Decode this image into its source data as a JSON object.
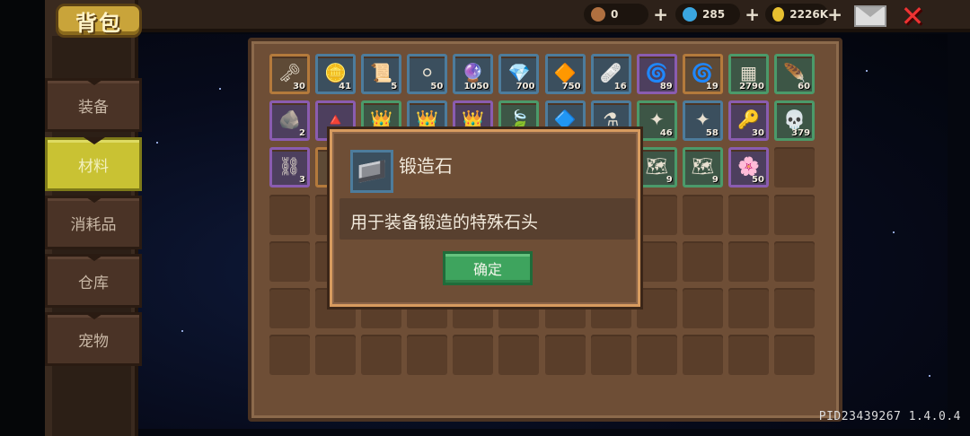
{
  "title": "背包",
  "tabs": [
    {
      "label": "装备",
      "active": false
    },
    {
      "label": "材料",
      "active": true
    },
    {
      "label": "消耗品",
      "active": false
    },
    {
      "label": "仓库",
      "active": false
    },
    {
      "label": "宠物",
      "active": false
    }
  ],
  "resources": [
    {
      "name": "sword-ticket",
      "value": "0",
      "color": "#b07040"
    },
    {
      "name": "gem",
      "value": "285",
      "color": "#3aa6e0"
    },
    {
      "name": "gold",
      "value": "2226K",
      "color": "#e8c030"
    }
  ],
  "items": [
    {
      "icon": "key-icon",
      "glyph": "🗝",
      "count": "30",
      "rarity": "orange"
    },
    {
      "icon": "coin-icon",
      "glyph": "🪙",
      "count": "41",
      "rarity": "blue"
    },
    {
      "icon": "scroll-icon",
      "glyph": "📜",
      "count": "5",
      "rarity": "blue"
    },
    {
      "icon": "orb-icon",
      "glyph": "⚪",
      "count": "50",
      "rarity": "blue"
    },
    {
      "icon": "purple-crystal-icon",
      "glyph": "🔮",
      "count": "1050",
      "rarity": "blue"
    },
    {
      "icon": "blue-crystal-icon",
      "glyph": "💎",
      "count": "700",
      "rarity": "blue"
    },
    {
      "icon": "gold-crystal-icon",
      "glyph": "🔶",
      "count": "750",
      "rarity": "blue"
    },
    {
      "icon": "bandage-icon",
      "glyph": "🩹",
      "count": "16",
      "rarity": "blue"
    },
    {
      "icon": "swirl-orb-icon",
      "glyph": "🌀",
      "count": "89",
      "rarity": "purple"
    },
    {
      "icon": "spiral-icon",
      "glyph": "🌀",
      "count": "19",
      "rarity": "orange"
    },
    {
      "icon": "chip-icon",
      "glyph": "▦",
      "count": "2790",
      "rarity": "green"
    },
    {
      "icon": "feather-icon",
      "glyph": "🪶",
      "count": "60",
      "rarity": "green"
    },
    {
      "icon": "ore-icon",
      "glyph": "🪨",
      "count": "2",
      "rarity": "purple"
    },
    {
      "icon": "prism-icon",
      "glyph": "🔺",
      "count": "",
      "rarity": "purple"
    },
    {
      "icon": "crown-icon",
      "glyph": "👑",
      "count": "",
      "rarity": "green"
    },
    {
      "icon": "crown-icon",
      "glyph": "👑",
      "count": "",
      "rarity": "blue"
    },
    {
      "icon": "crown-icon",
      "glyph": "👑",
      "count": "",
      "rarity": "purple"
    },
    {
      "icon": "leaf-icon",
      "glyph": "🍃",
      "count": "",
      "rarity": "green"
    },
    {
      "icon": "blade-icon",
      "glyph": "🔷",
      "count": "",
      "rarity": "blue"
    },
    {
      "icon": "potion-icon",
      "glyph": "⚗",
      "count": "",
      "rarity": "blue"
    },
    {
      "icon": "rune-icon",
      "glyph": "✦",
      "count": "46",
      "rarity": "green"
    },
    {
      "icon": "rune-icon",
      "glyph": "✦",
      "count": "58",
      "rarity": "blue"
    },
    {
      "icon": "magic-key-icon",
      "glyph": "🔑",
      "count": "30",
      "rarity": "purple"
    },
    {
      "icon": "skull-icon",
      "glyph": "💀",
      "count": "379",
      "rarity": "green"
    },
    {
      "icon": "chain-icon",
      "glyph": "⛓",
      "count": "3",
      "rarity": "purple"
    },
    {
      "icon": "item-icon",
      "glyph": "",
      "count": "",
      "rarity": "orange"
    },
    {
      "icon": "empty",
      "glyph": "",
      "count": "",
      "rarity": "none"
    },
    {
      "icon": "empty",
      "glyph": "",
      "count": "",
      "rarity": "none"
    },
    {
      "icon": "empty",
      "glyph": "",
      "count": "",
      "rarity": "none"
    },
    {
      "icon": "empty",
      "glyph": "",
      "count": "",
      "rarity": "none"
    },
    {
      "icon": "empty",
      "glyph": "",
      "count": "",
      "rarity": "none"
    },
    {
      "icon": "empty",
      "glyph": "",
      "count": "",
      "rarity": "none"
    },
    {
      "icon": "map-icon",
      "glyph": "🗺",
      "count": "9",
      "rarity": "green"
    },
    {
      "icon": "map-icon",
      "glyph": "🗺",
      "count": "9",
      "rarity": "green"
    },
    {
      "icon": "flower-icon",
      "glyph": "🌸",
      "count": "50",
      "rarity": "purple"
    },
    {
      "icon": "empty",
      "glyph": "",
      "count": "",
      "rarity": "none"
    }
  ],
  "empty_rows": 4,
  "dialog": {
    "item_name": "锻造石",
    "description": "用于装备锻造的特殊石头",
    "confirm_label": "确定"
  },
  "version": "PID23439267 1.4.0.4"
}
